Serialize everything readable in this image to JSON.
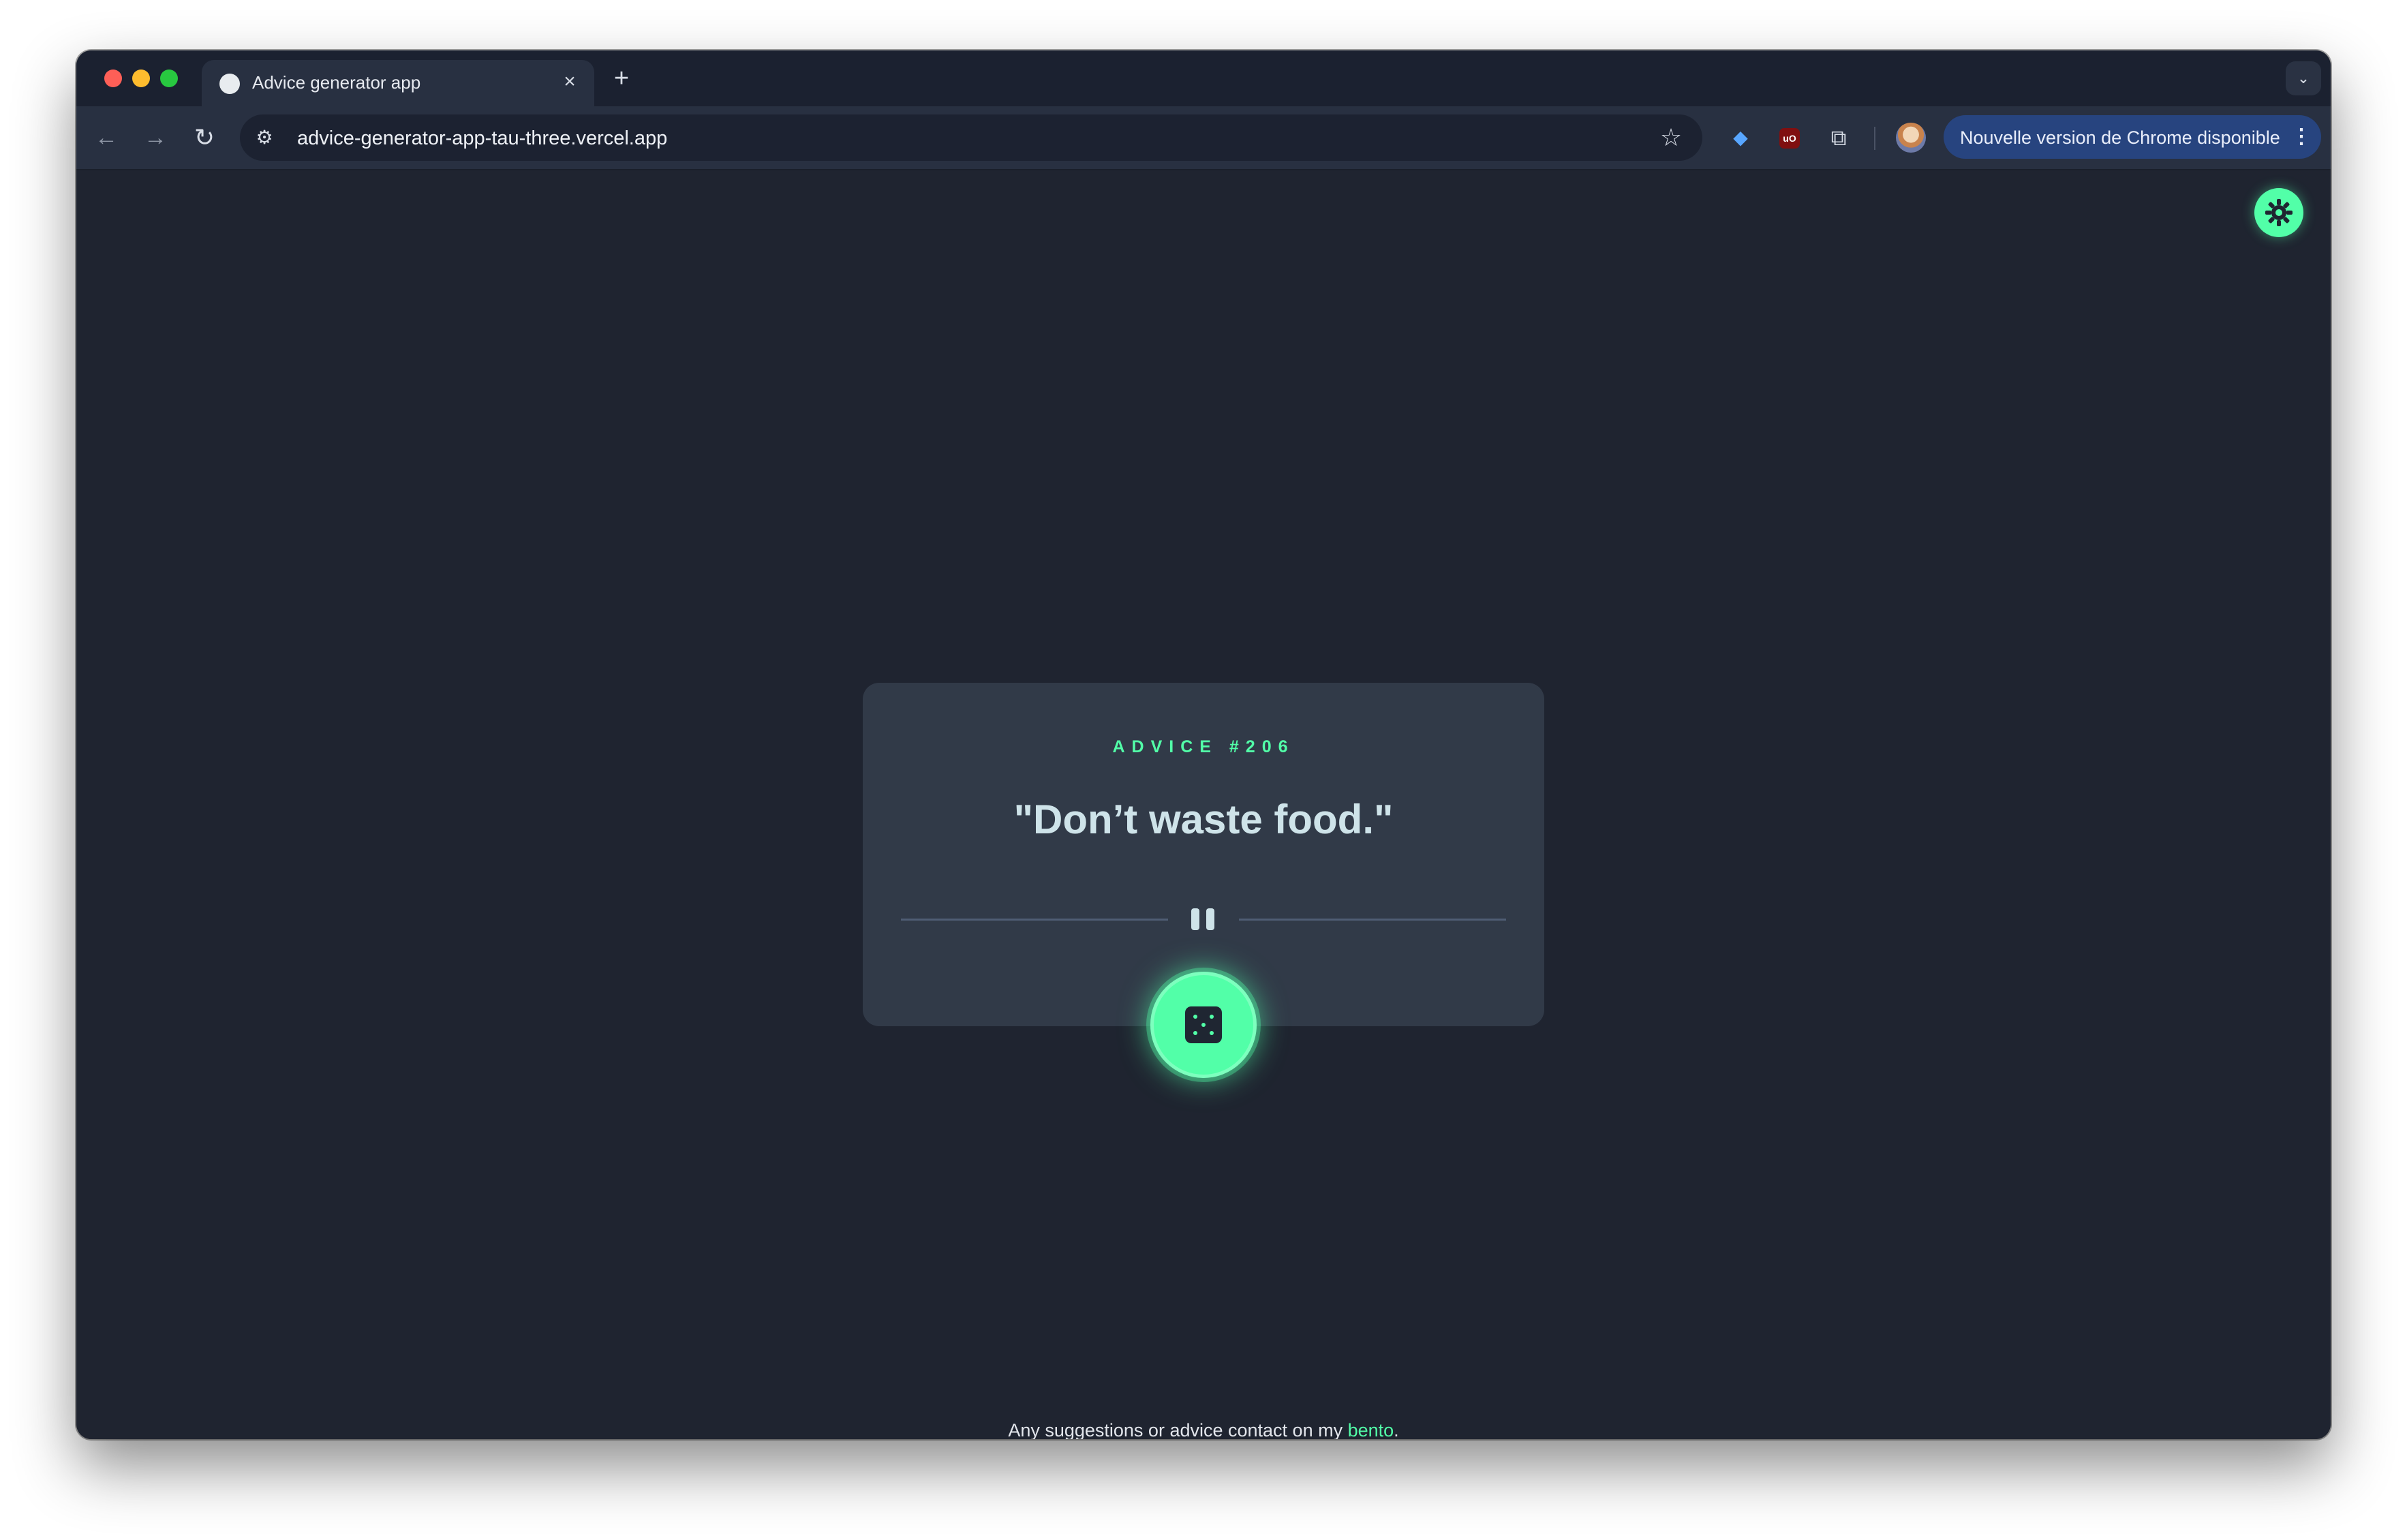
{
  "browser": {
    "tab": {
      "title": "Advice generator app",
      "close_icon": "close-icon"
    },
    "new_tab_icon": "plus-icon",
    "tab_list_icon": "chevron-down-icon",
    "toolbar": {
      "back_icon": "arrow-left-icon",
      "forward_icon": "arrow-right-icon",
      "reload_icon": "reload-icon",
      "url": "advice-generator-app-tau-three.vercel.app",
      "site_info_icon": "tune-icon",
      "bookmark_icon": "star-icon",
      "update_label": "Nouvelle version de Chrome disponible",
      "menu_icon": "kebab-menu-icon"
    },
    "extensions": [
      "gem-extension-icon",
      "ublock-extension-icon",
      "puzzle-extensions-icon"
    ],
    "ublock_badge": "uO"
  },
  "page": {
    "theme_toggle_icon": "sun-gear-icon",
    "card": {
      "advice_id_label": "ADVICE #206",
      "advice_text": "\"Don’t waste food.\""
    },
    "dice_button_icon": "dice-icon",
    "footer": {
      "text": "Any suggestions or advice contact on my ",
      "link_text": "bento",
      "trailing": "."
    }
  },
  "colors": {
    "accent": "#52ffa8",
    "page_bg": "#1f2430",
    "card_bg": "#313a48",
    "quote_text": "#cee3e9",
    "update_pill": "#27447f"
  }
}
